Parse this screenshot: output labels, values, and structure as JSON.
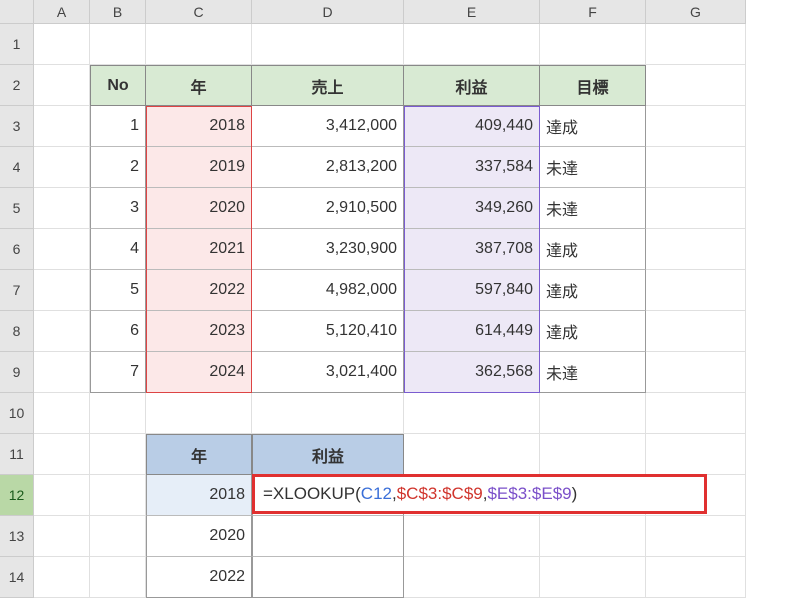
{
  "columns": [
    "",
    "A",
    "B",
    "C",
    "D",
    "E",
    "F",
    "G"
  ],
  "rows": [
    "1",
    "2",
    "3",
    "4",
    "5",
    "6",
    "7",
    "8",
    "9",
    "10",
    "11",
    "12",
    "13",
    "14"
  ],
  "active_row": "12",
  "table": {
    "headers": {
      "no": "No",
      "year": "年",
      "sales": "売上",
      "profit": "利益",
      "target": "目標"
    },
    "data": [
      {
        "no": "1",
        "year": "2018",
        "sales": "3,412,000",
        "profit": "409,440",
        "target": "達成"
      },
      {
        "no": "2",
        "year": "2019",
        "sales": "2,813,200",
        "profit": "337,584",
        "target": "未達"
      },
      {
        "no": "3",
        "year": "2020",
        "sales": "2,910,500",
        "profit": "349,260",
        "target": "未達"
      },
      {
        "no": "4",
        "year": "2021",
        "sales": "3,230,900",
        "profit": "387,708",
        "target": "達成"
      },
      {
        "no": "5",
        "year": "2022",
        "sales": "4,982,000",
        "profit": "597,840",
        "target": "達成"
      },
      {
        "no": "6",
        "year": "2023",
        "sales": "5,120,410",
        "profit": "614,449",
        "target": "達成"
      },
      {
        "no": "7",
        "year": "2024",
        "sales": "3,021,400",
        "profit": "362,568",
        "target": "未達"
      }
    ]
  },
  "lookup": {
    "headers": {
      "year": "年",
      "profit": "利益"
    },
    "rows": [
      {
        "year": "2018",
        "profit": ""
      },
      {
        "year": "2020",
        "profit": ""
      },
      {
        "year": "2022",
        "profit": ""
      }
    ]
  },
  "formula": {
    "prefix": "=XLOOKUP(",
    "arg1": "C12",
    "sep": ",",
    "arg2": "$C$3:$C$9",
    "arg3": "$E$3:$E$9",
    "suffix": ")"
  },
  "chart_data": {
    "type": "table",
    "title": "",
    "columns": [
      "No",
      "年",
      "売上",
      "利益",
      "目標"
    ],
    "rows": [
      [
        1,
        2018,
        3412000,
        409440,
        "達成"
      ],
      [
        2,
        2019,
        2813200,
        337584,
        "未達"
      ],
      [
        3,
        2020,
        2910500,
        349260,
        "未達"
      ],
      [
        4,
        2021,
        3230900,
        387708,
        "達成"
      ],
      [
        5,
        2022,
        4982000,
        597840,
        "達成"
      ],
      [
        6,
        2023,
        5120410,
        614449,
        "達成"
      ],
      [
        7,
        2024,
        3021400,
        362568,
        "未達"
      ]
    ]
  }
}
